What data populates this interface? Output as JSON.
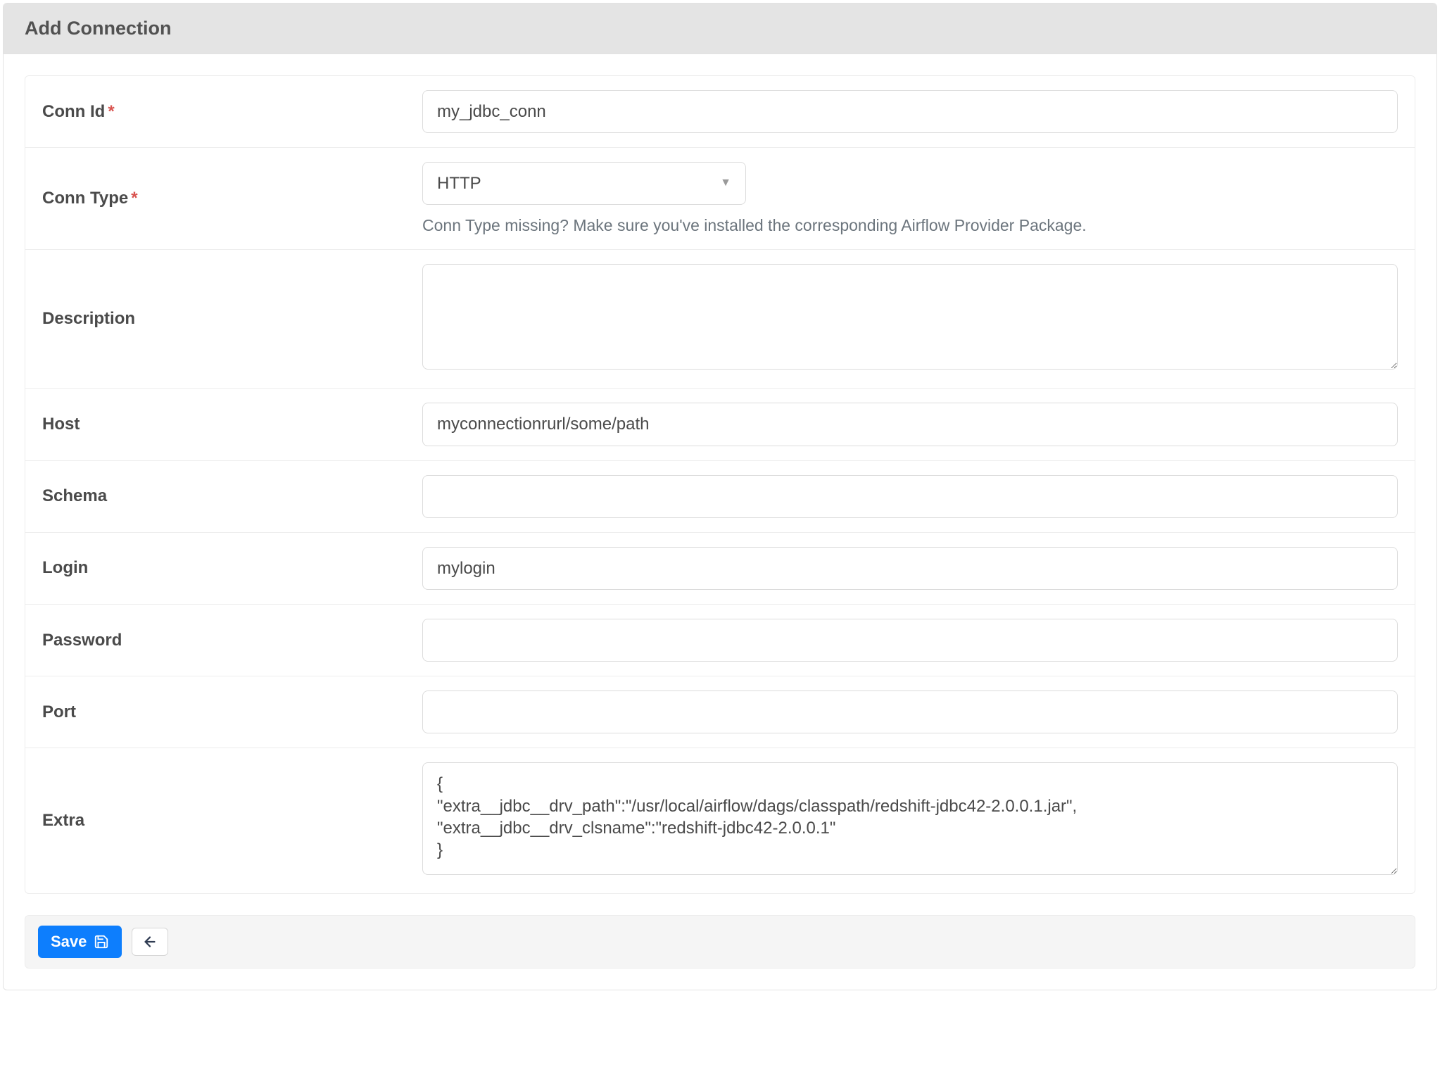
{
  "header": {
    "title": "Add Connection"
  },
  "fields": {
    "conn_id": {
      "label": "Conn Id",
      "required": true,
      "value": "my_jdbc_conn"
    },
    "conn_type": {
      "label": "Conn Type",
      "required": true,
      "selected": "HTTP",
      "help": "Conn Type missing? Make sure you've installed the corresponding Airflow Provider Package."
    },
    "description": {
      "label": "Description",
      "value": ""
    },
    "host": {
      "label": "Host",
      "value": "myconnectionrurl/some/path"
    },
    "schema": {
      "label": "Schema",
      "value": ""
    },
    "login": {
      "label": "Login",
      "value": "mylogin"
    },
    "password": {
      "label": "Password",
      "value": ""
    },
    "port": {
      "label": "Port",
      "value": ""
    },
    "extra": {
      "label": "Extra",
      "value": "{\n\"extra__jdbc__drv_path\":\"/usr/local/airflow/dags/classpath/redshift-jdbc42-2.0.0.1.jar\",\n\"extra__jdbc__drv_clsname\":\"redshift-jdbc42-2.0.0.1\"\n}"
    }
  },
  "footer": {
    "save_label": "Save"
  }
}
